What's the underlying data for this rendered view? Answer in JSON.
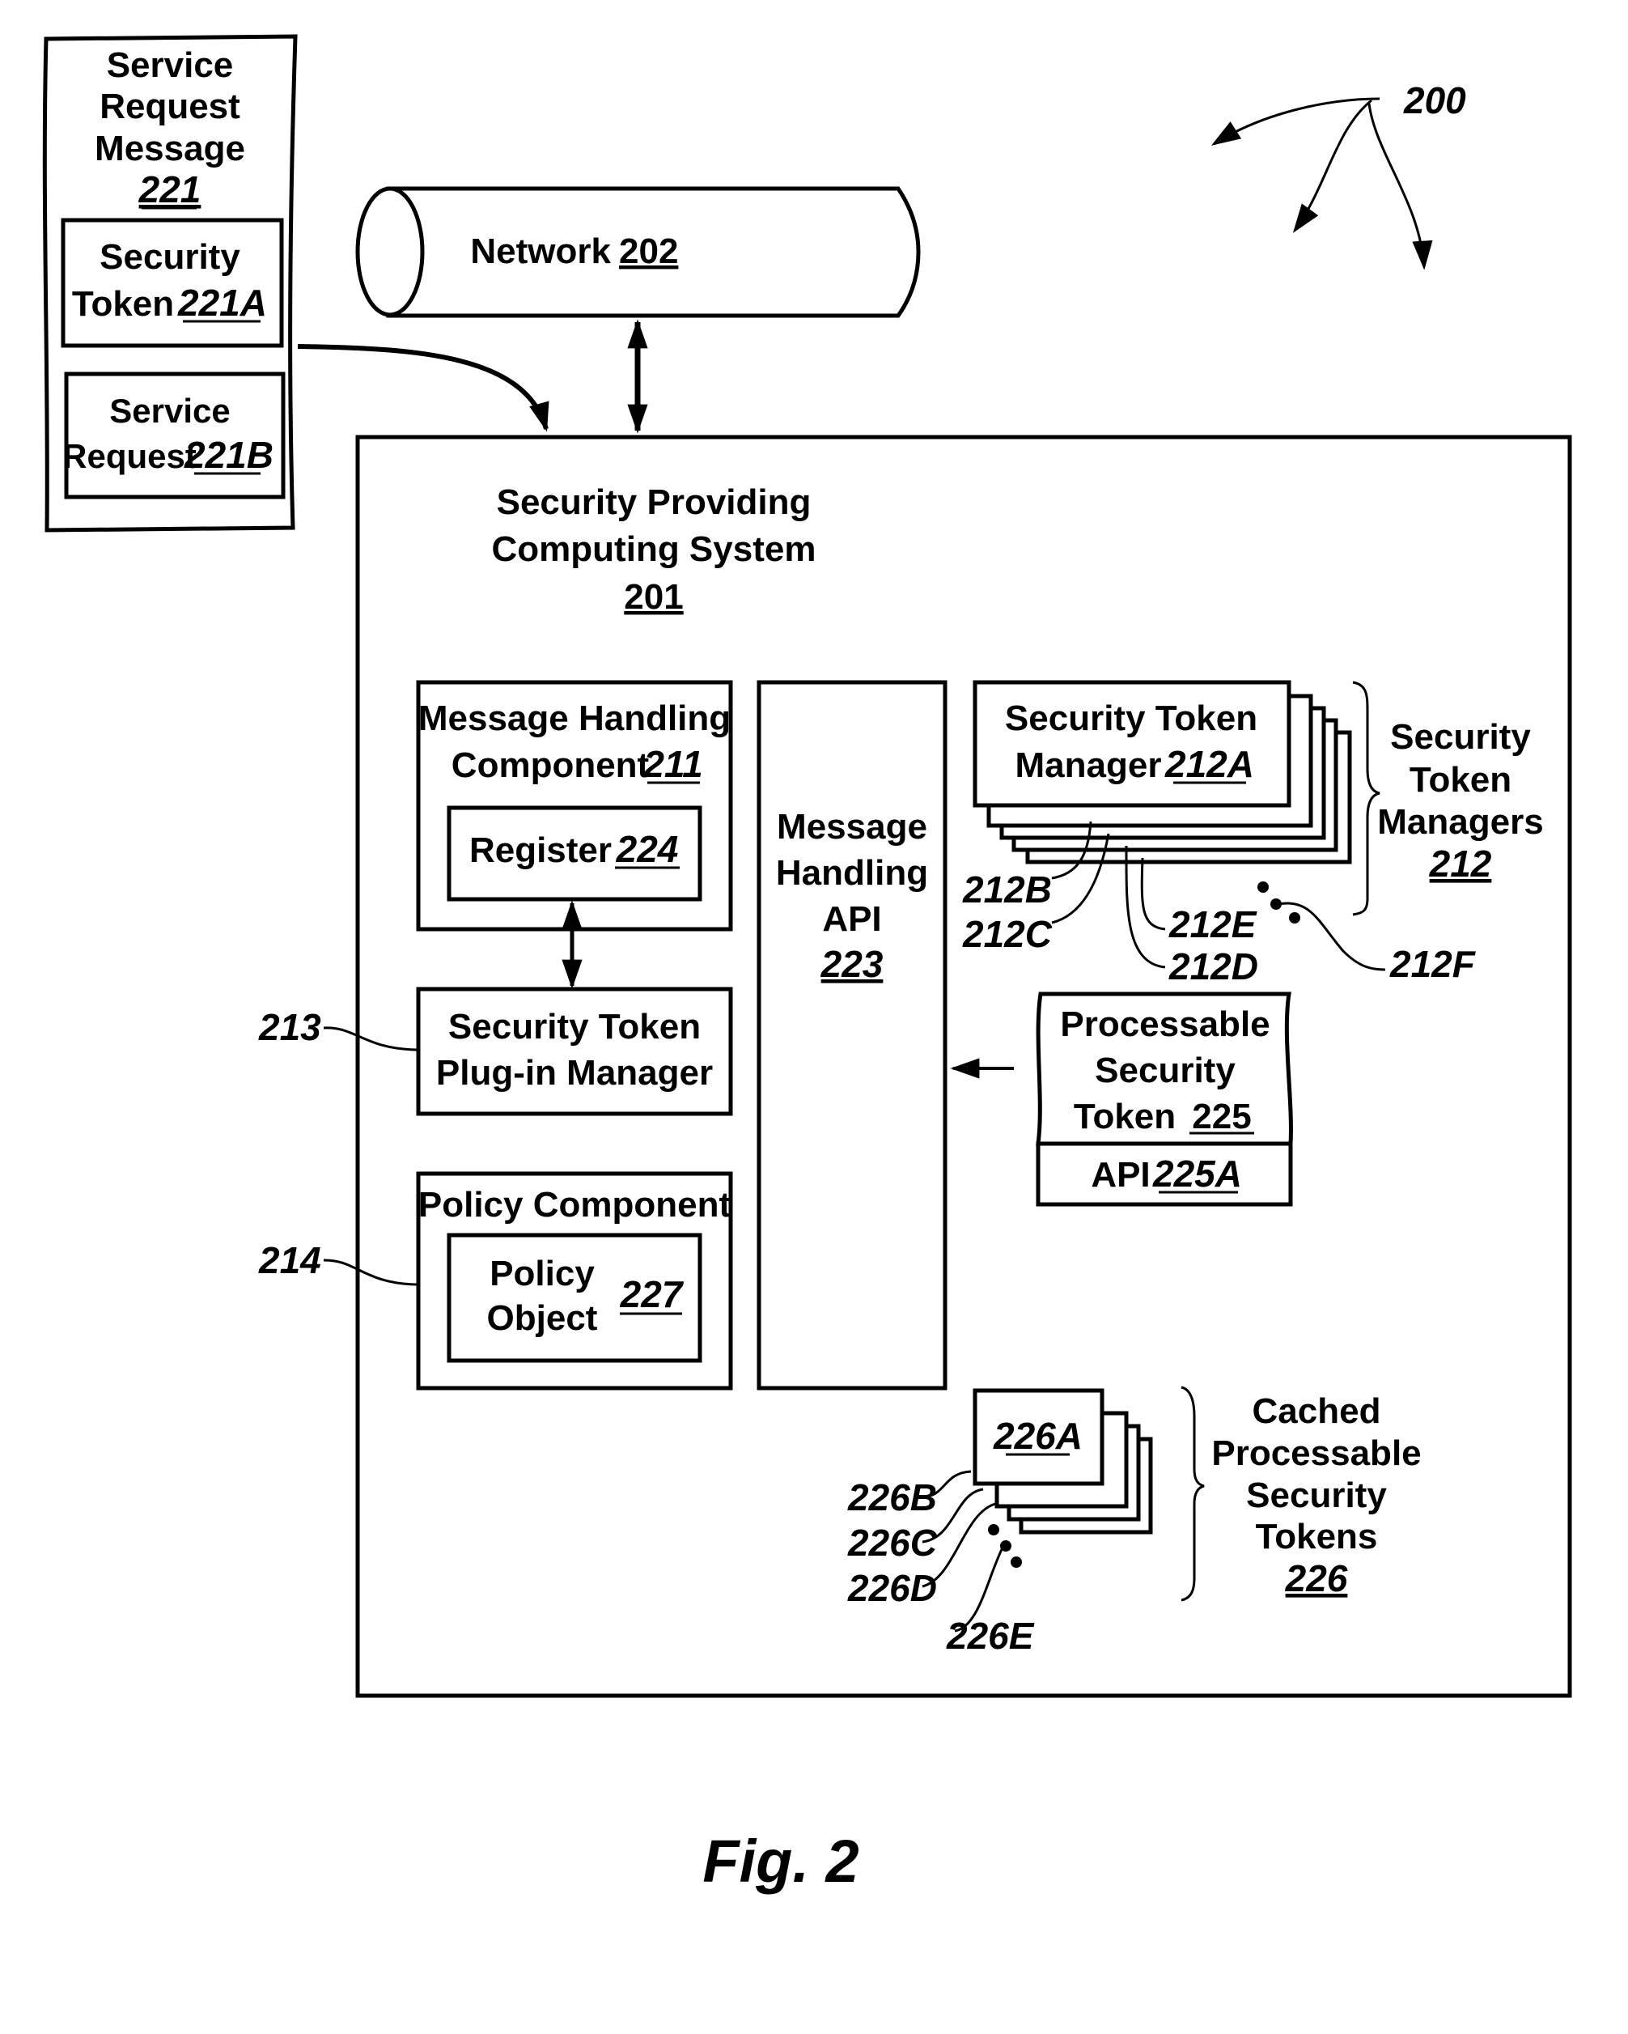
{
  "figure": {
    "caption": "Fig. 2",
    "reference": "200"
  },
  "service_request_message": {
    "lines": [
      "Service",
      "Request",
      "Message"
    ],
    "ref": "221",
    "security_token": {
      "lines": [
        "Security",
        "Token"
      ],
      "ref": "221A"
    },
    "service_request": {
      "lines": [
        "Service",
        "Request"
      ],
      "ref": "221B"
    }
  },
  "network": {
    "label": "Network",
    "ref": "202"
  },
  "system": {
    "lines": [
      "Security Providing",
      "Computing System"
    ],
    "ref": "201",
    "message_handling_component": {
      "lines": [
        "Message Handling",
        "Component"
      ],
      "ref": "211"
    },
    "register": {
      "label": "Register",
      "ref": "224"
    },
    "plugin_manager": {
      "lines": [
        "Security Token",
        "Plug-in Manager"
      ],
      "ref": "213"
    },
    "policy_component": {
      "label": "Policy Component",
      "ref": "214"
    },
    "policy_object": {
      "lines": [
        "Policy",
        "Object"
      ],
      "ref": "227"
    },
    "message_handling_api": {
      "lines": [
        "Message",
        "Handling",
        "API"
      ],
      "ref": "223"
    },
    "token_managers": {
      "primary": {
        "lines": [
          "Security Token",
          "Manager"
        ],
        "ref": "212A"
      },
      "stack_refs": [
        "212B",
        "212C",
        "212D",
        "212E",
        "212F"
      ],
      "group_lines": [
        "Security",
        "Token",
        "Managers"
      ],
      "group_ref": "212"
    },
    "processable_token": {
      "lines": [
        "Processable",
        "Security",
        "Token"
      ],
      "ref": "225",
      "api_label": "API",
      "api_ref": "225A"
    },
    "cached_tokens": {
      "primary_ref": "226A",
      "stack_refs": [
        "226B",
        "226C",
        "226D",
        "226E"
      ],
      "group_lines": [
        "Cached",
        "Processable",
        "Security",
        "Tokens"
      ],
      "group_ref": "226"
    }
  }
}
